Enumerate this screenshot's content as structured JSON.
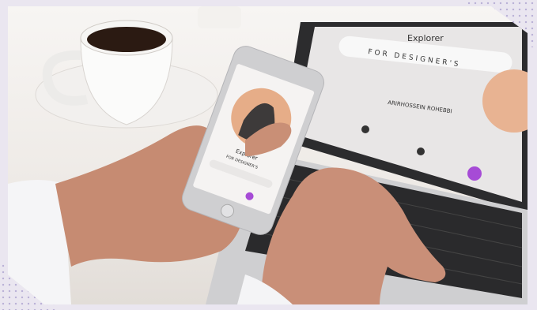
{
  "laptop_screen": {
    "title": "Explorer",
    "subtitle": "FOR DESIGNER'S",
    "credit": "ARIRHOSSEIN ROHEBBI",
    "accent": "#a64bd6"
  },
  "phone_screen": {
    "title": "Explorer",
    "subtitle": "FOR DESIGNER'S",
    "accent": "#a64bd6"
  },
  "colors": {
    "frame_bg": "#eae6f0",
    "coffee": "#2b1a12"
  }
}
